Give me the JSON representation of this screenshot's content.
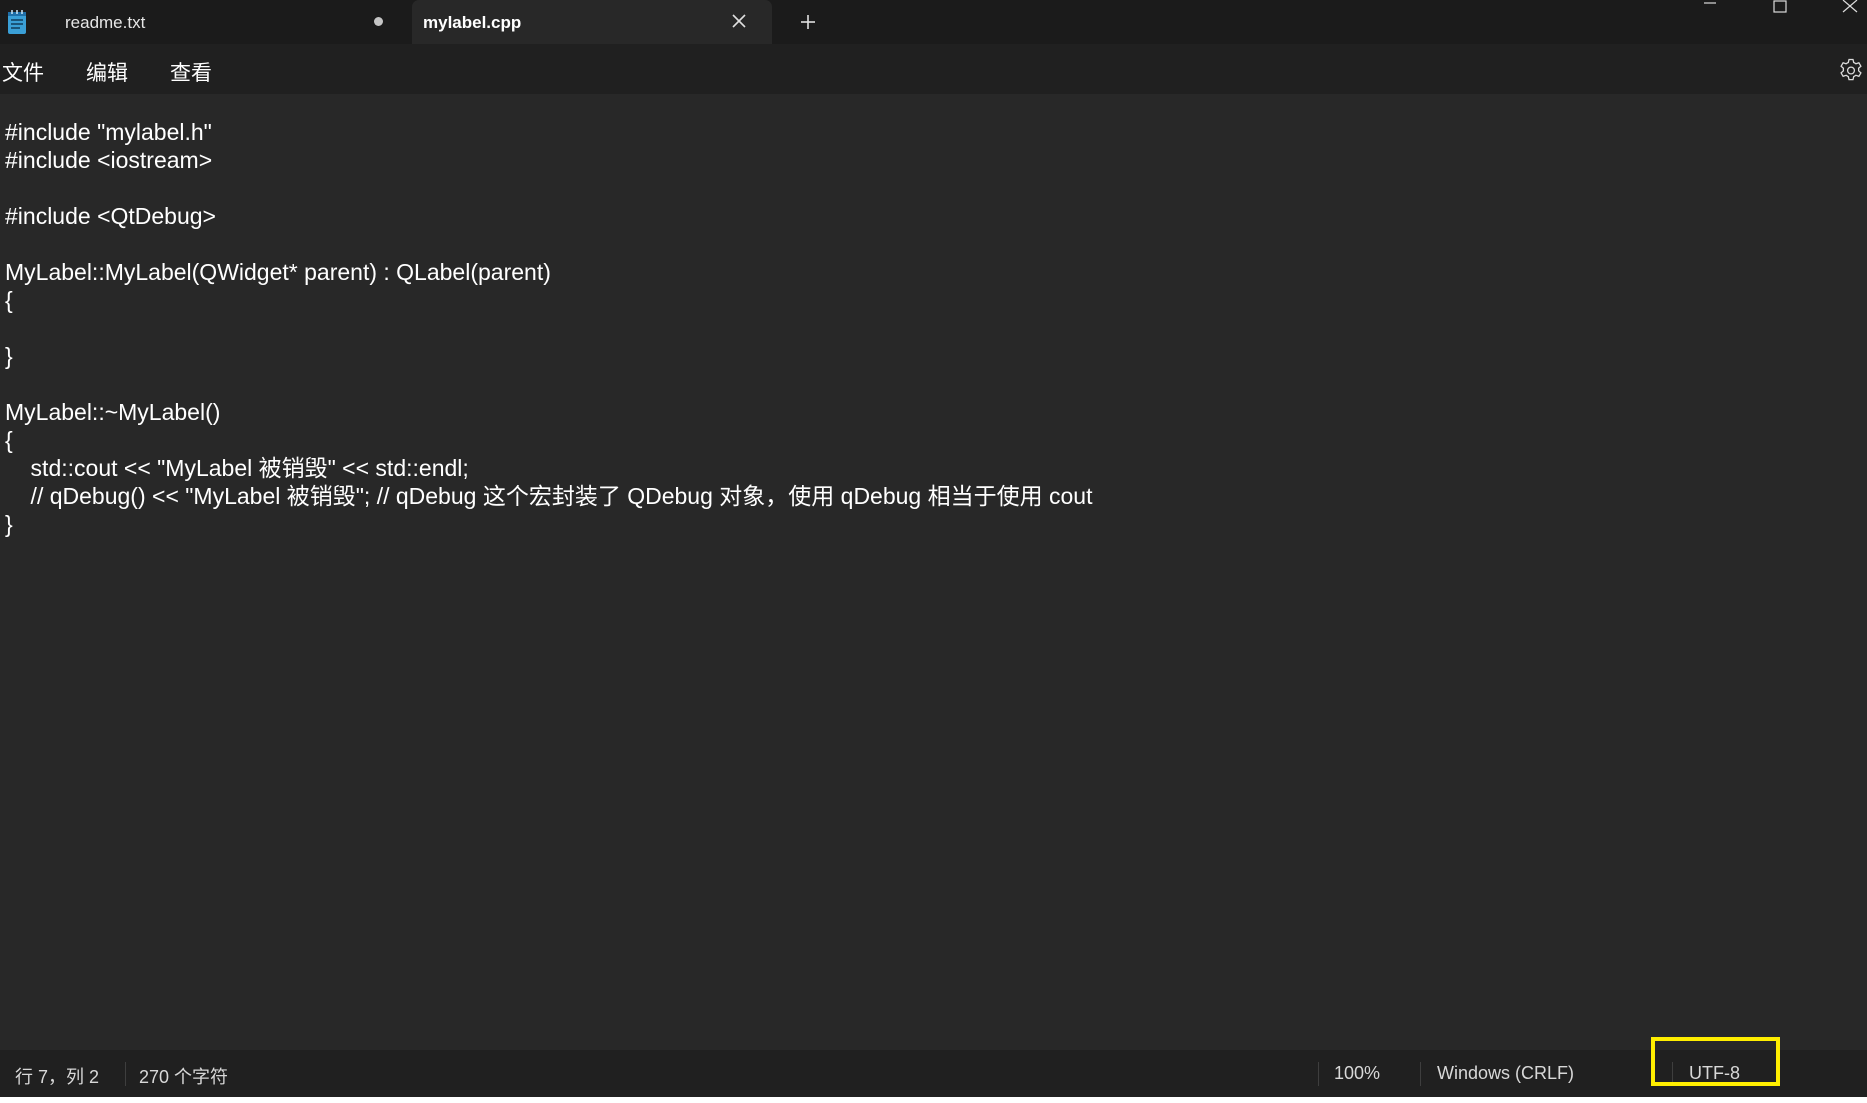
{
  "tabs": [
    {
      "label": "readme.txt",
      "unsaved": true
    },
    {
      "label": "mylabel.cpp",
      "active": true
    }
  ],
  "menu": {
    "file": "文件",
    "edit": "编辑",
    "view": "查看"
  },
  "editor": {
    "lines": [
      "#include \"mylabel.h\"",
      "#include <iostream>",
      "",
      "#include <QtDebug>",
      "",
      "MyLabel::MyLabel(QWidget* parent) : QLabel(parent)",
      "{",
      "",
      "}",
      "",
      "MyLabel::~MyLabel()",
      "{",
      "    std::cout << \"MyLabel 被销毁\" << std::endl;",
      "    // qDebug() << \"MyLabel 被销毁\"; // qDebug 这个宏封装了 QDebug 对象，使用 qDebug 相当于使用 cout",
      "}"
    ]
  },
  "status": {
    "position": "行 7，列 2",
    "char_count": "270 个字符",
    "zoom": "100%",
    "line_ending": "Windows (CRLF)",
    "encoding": "UTF-8"
  },
  "colors": {
    "editor_bg": "#282828",
    "titlebar_bg": "#1b1b1b",
    "highlight": "#ffee00"
  }
}
